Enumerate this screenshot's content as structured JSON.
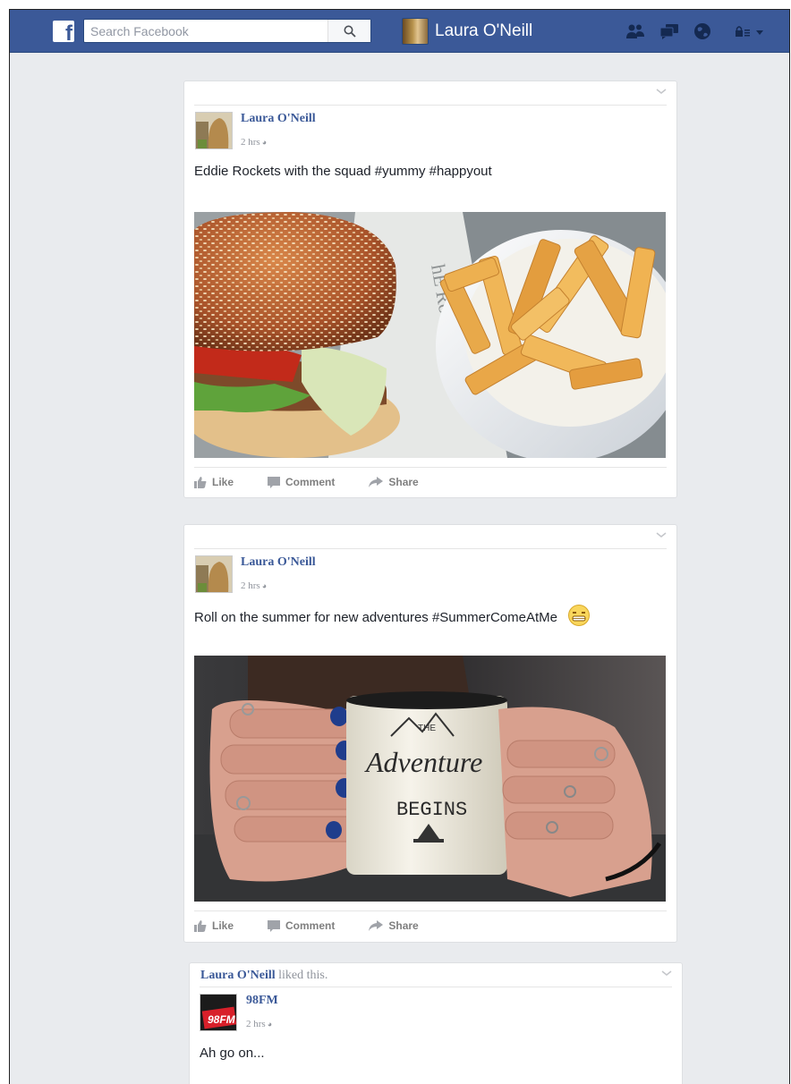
{
  "topbar": {
    "logo_letter": "f",
    "search_placeholder": "Search Facebook",
    "profile_name": "Laura O'Neill",
    "icons": [
      "friend-requests-icon",
      "messages-icon",
      "notifications-globe-icon",
      "privacy-lock-icon",
      "account-menu-caret-icon"
    ]
  },
  "posts": [
    {
      "author": "Laura O'Neill",
      "time": "2 hrs",
      "text": "Eddie Rockets with the squad #yummy #happyout",
      "photo": "burger-and-fries-photo",
      "actions": {
        "like": "Like",
        "comment": "Comment",
        "share": "Share"
      }
    },
    {
      "author": "Laura O'Neill",
      "time": "2 hrs",
      "text": "Roll on the summer for new adventures #SummerComeAtMe",
      "emoji": "grimacing-face",
      "photo": "adventure-mug-photo",
      "mug_text": {
        "line1": "THE",
        "line2": "Adventure",
        "line3": "BEGINS"
      },
      "actions": {
        "like": "Like",
        "comment": "Comment",
        "share": "Share"
      }
    },
    {
      "liked_by": "Laura O'Neill",
      "liked_suffix": "liked this.",
      "author": "98FM",
      "logo_text": "98FM",
      "time": "2 hrs",
      "text": "Ah go on..."
    }
  ]
}
